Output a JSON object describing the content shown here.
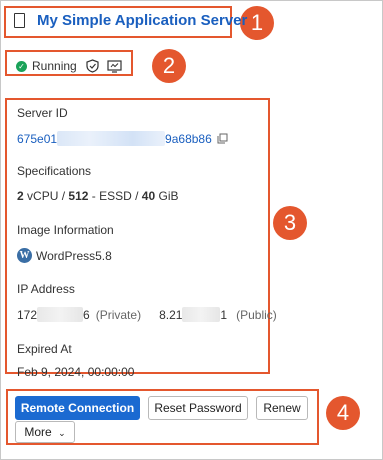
{
  "header": {
    "title": "My Simple Application Server"
  },
  "status": {
    "text": "Running"
  },
  "details": {
    "server_id": {
      "label": "Server ID",
      "value_prefix": "675e01",
      "value_suffix": "9a68b86"
    },
    "specifications": {
      "label": "Specifications",
      "cpu_count": "2",
      "cpu_unit": "vCPU",
      "memory": "512",
      "disk_type": "ESSD",
      "disk_size": "40",
      "disk_unit": "GiB"
    },
    "image": {
      "label": "Image Information",
      "value": "WordPress5.8"
    },
    "ip": {
      "label": "IP Address",
      "private_prefix": "172",
      "private_suffix": "6",
      "private_tag": "(Private)",
      "public_prefix": "8.21",
      "public_suffix": "1",
      "public_tag": "(Public)"
    },
    "expired": {
      "label": "Expired At",
      "value": "Feb 9, 2024, 00:00:00"
    }
  },
  "actions": {
    "remote_connection": "Remote Connection",
    "reset_password": "Reset Password",
    "renew": "Renew",
    "more": "More"
  },
  "callouts": [
    "1",
    "2",
    "3",
    "4"
  ],
  "colors": {
    "callout": "#e4572e",
    "link": "#1a5fbf",
    "primary_button": "#1b6ad1",
    "running": "#1aa259"
  }
}
